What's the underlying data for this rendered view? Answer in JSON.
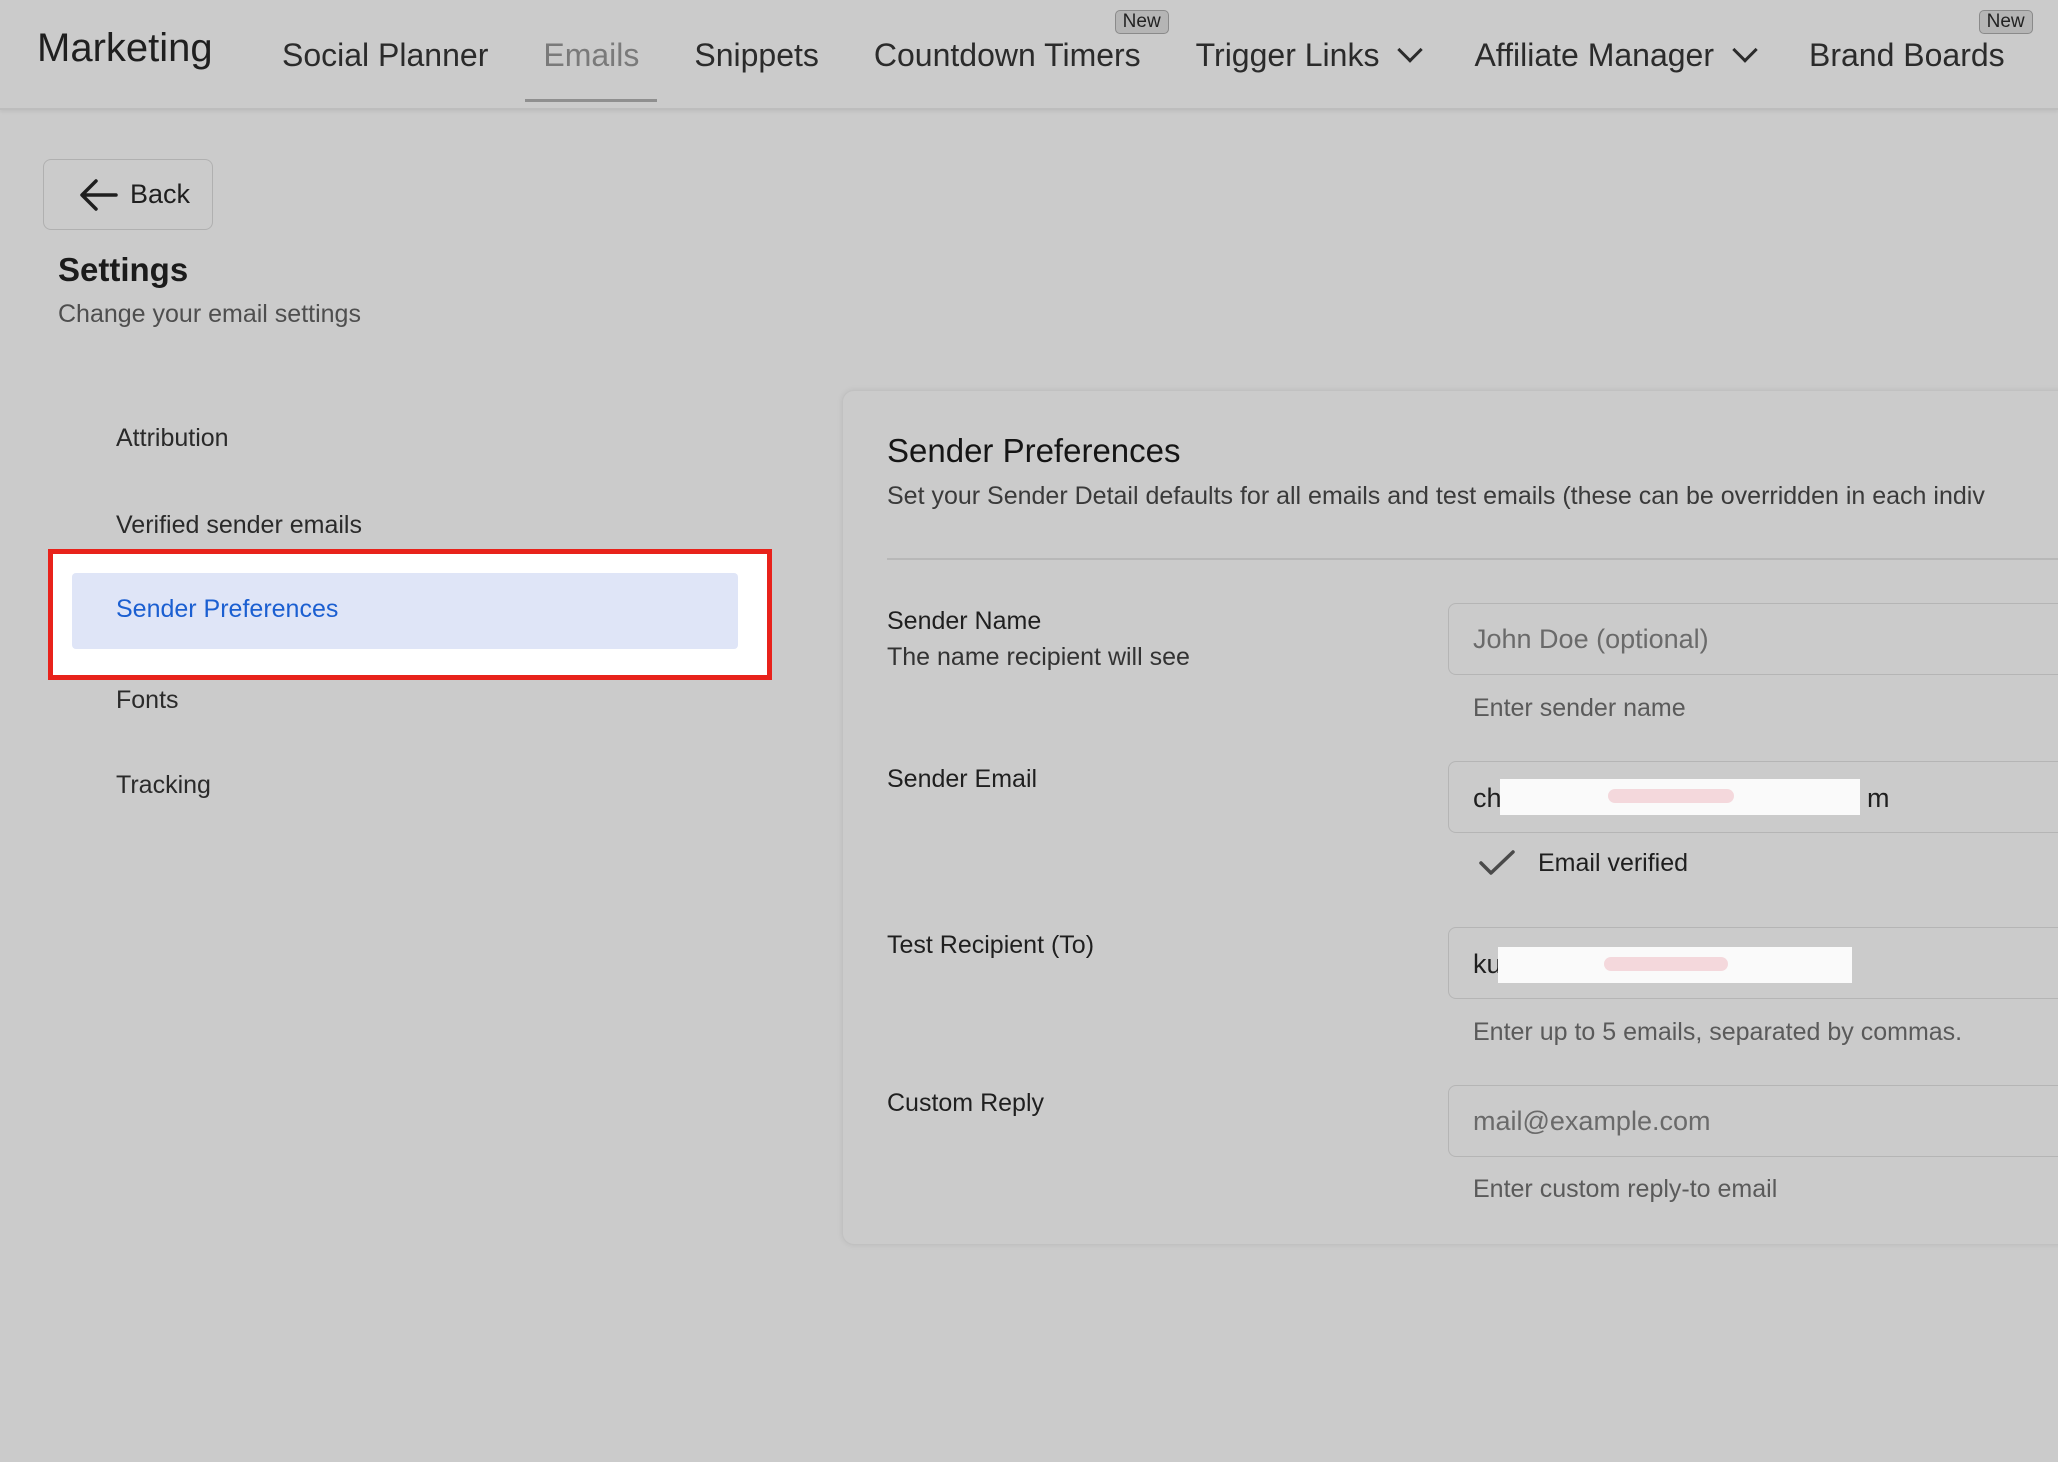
{
  "app": {
    "title": "Marketing"
  },
  "nav": {
    "items": [
      {
        "label": "Social Planner",
        "active": false,
        "dropdown": false,
        "badge": ""
      },
      {
        "label": "Emails",
        "active": true,
        "dropdown": false,
        "badge": ""
      },
      {
        "label": "Snippets",
        "active": false,
        "dropdown": false,
        "badge": ""
      },
      {
        "label": "Countdown Timers",
        "active": false,
        "dropdown": false,
        "badge": "New"
      },
      {
        "label": "Trigger Links",
        "active": false,
        "dropdown": true,
        "badge": ""
      },
      {
        "label": "Affiliate Manager",
        "active": false,
        "dropdown": true,
        "badge": ""
      },
      {
        "label": "Brand Boards",
        "active": false,
        "dropdown": false,
        "badge": "New"
      }
    ]
  },
  "back": {
    "label": "Back",
    "icon": "arrow-left-icon"
  },
  "page": {
    "title": "Settings",
    "subtitle": "Change your email settings"
  },
  "menu": {
    "items": [
      {
        "label": "Attribution"
      },
      {
        "label": "Verified sender emails"
      },
      {
        "label": "Sender Preferences",
        "selected": true
      },
      {
        "label": "Fonts"
      },
      {
        "label": "Tracking"
      }
    ]
  },
  "card": {
    "title": "Sender Preferences",
    "description": "Set your Sender Detail defaults for all emails and test emails (these can be overridden in each indiv",
    "sender_name": {
      "label": "Sender Name",
      "sublabel": "The name recipient will see",
      "placeholder": "John Doe (optional)",
      "value": "",
      "help": "Enter sender name"
    },
    "sender_email": {
      "label": "Sender Email",
      "value_prefix": "ch",
      "value_suffix": "m",
      "verified_label": "Email verified",
      "verified_icon": "checkmark-icon"
    },
    "test_recipient": {
      "label": "Test Recipient (To)",
      "value_prefix": "ku",
      "help": "Enter up to 5 emails, separated by commas."
    },
    "custom_reply": {
      "label": "Custom Reply",
      "placeholder": "mail@example.com",
      "value": "",
      "help": "Enter custom reply-to email"
    }
  },
  "colors": {
    "background": "#cbcbcb",
    "selected_bg": "#dfe5f7",
    "selected_text": "#1b5fd1",
    "highlight_border": "#e8221b"
  }
}
